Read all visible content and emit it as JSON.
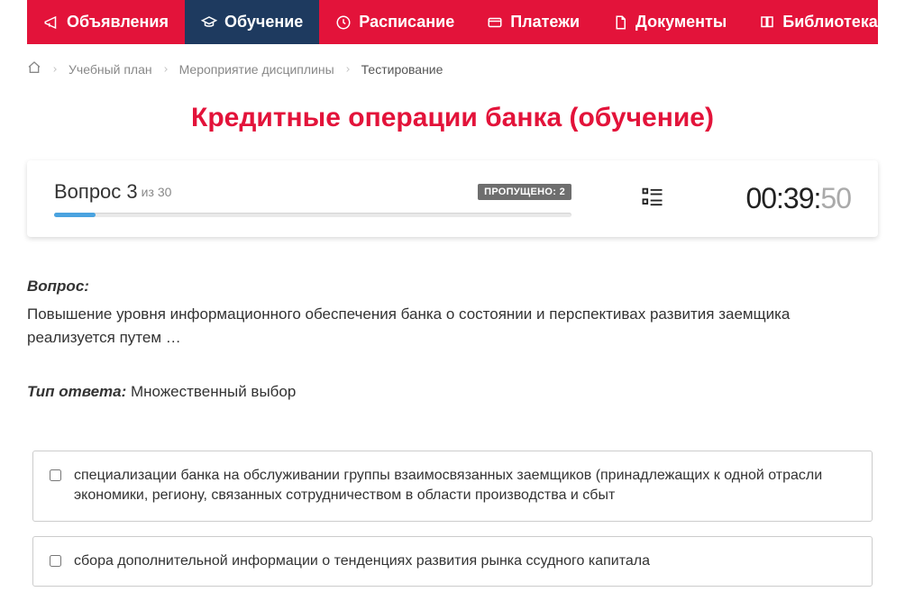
{
  "nav": {
    "items": [
      {
        "label": "Объявления",
        "icon": "megaphone",
        "active": false
      },
      {
        "label": "Обучение",
        "icon": "grad-cap",
        "active": true
      },
      {
        "label": "Расписание",
        "icon": "clock",
        "active": false
      },
      {
        "label": "Платежи",
        "icon": "card",
        "active": false
      },
      {
        "label": "Документы",
        "icon": "doc",
        "active": false
      },
      {
        "label": "Библиотека",
        "icon": "book",
        "active": false,
        "chevron": true
      }
    ]
  },
  "breadcrumb": {
    "items": [
      "Учебный план",
      "Мероприятие дисциплины"
    ],
    "current": "Тестирование"
  },
  "title": "Кредитные операции банка (обучение)",
  "status": {
    "question_word": "Вопрос",
    "question_number": "3",
    "of_word": "из",
    "total": "30",
    "skipped_label": "ПРОПУЩЕНО: 2",
    "progress_percent": 8,
    "timer_main": "00:39:",
    "timer_sec": "50"
  },
  "question": {
    "label": "Вопрос:",
    "text": "Повышение уровня информационного обеспечения банка о состоянии и перспективах развития заемщика реализуется путем …"
  },
  "answer_type": {
    "label": "Тип ответа:",
    "value": "Множественный выбор"
  },
  "options": [
    "специализации банка на обслуживании группы взаимосвязанных заемщиков (принадлежащих к одной отрасли экономики, региону, связанных сотрудничеством в области производства и сбыт",
    "сбора дополнительной информации о тенденциях развития рынка ссудного капитала"
  ]
}
